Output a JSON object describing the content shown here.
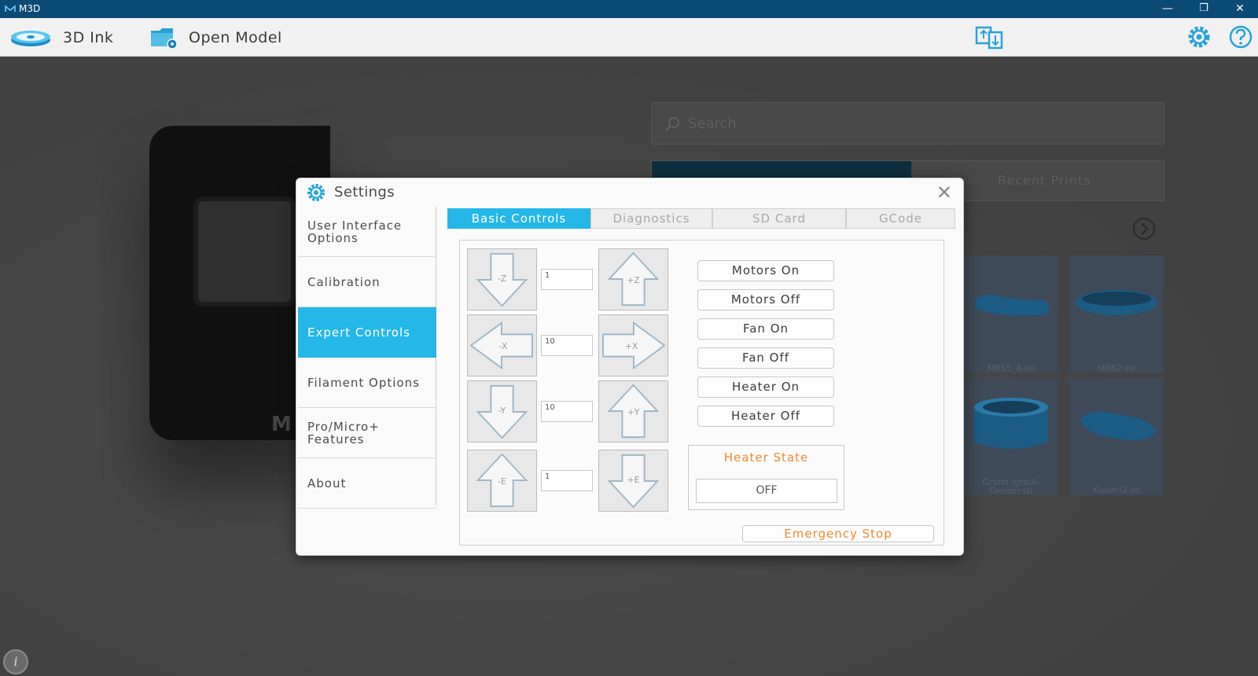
{
  "window": {
    "title": "M3D",
    "minimize": "—",
    "restore": "❐",
    "close": "✕"
  },
  "toolbar": {
    "ink_label": "3D Ink",
    "open_model_label": "Open Model"
  },
  "library": {
    "search_placeholder": "Search",
    "recent_prints_tab": "Recent Prints",
    "models": [
      "MBS5_A.stl",
      "MBS2.stl",
      "Grand Jgttuli-Densor.stl",
      "Xiaomi2.stl"
    ]
  },
  "settings": {
    "title": "Settings",
    "close": "✕",
    "sidebar": [
      {
        "label": "User Interface Options"
      },
      {
        "label": "Calibration"
      },
      {
        "label": "Expert Controls",
        "active": true
      },
      {
        "label": "Filament Options"
      },
      {
        "label": "Pro/Micro+ Features"
      },
      {
        "label": "About"
      }
    ],
    "tabs": [
      {
        "label": "Basic Controls",
        "active": true
      },
      {
        "label": "Diagnostics"
      },
      {
        "label": "SD Card"
      },
      {
        "label": "GCode"
      }
    ],
    "axes": [
      {
        "minus": "-Z",
        "plus": "+Z",
        "step": "1"
      },
      {
        "minus": "-X",
        "plus": "+X",
        "step": "10"
      },
      {
        "minus": "-Y",
        "plus": "+Y",
        "step": "10"
      },
      {
        "minus": "-E",
        "plus": "+E",
        "step": "1"
      }
    ],
    "commands": [
      "Motors On",
      "Motors Off",
      "Fan On",
      "Fan Off",
      "Heater On",
      "Heater Off"
    ],
    "heater_state_label": "Heater State",
    "heater_state_value": "OFF",
    "emergency_stop": "Emergency Stop"
  },
  "info_button": "i",
  "colors": {
    "accent": "#25b7e8",
    "titlebar": "#0b4a76",
    "warning": "#f08a2c"
  }
}
